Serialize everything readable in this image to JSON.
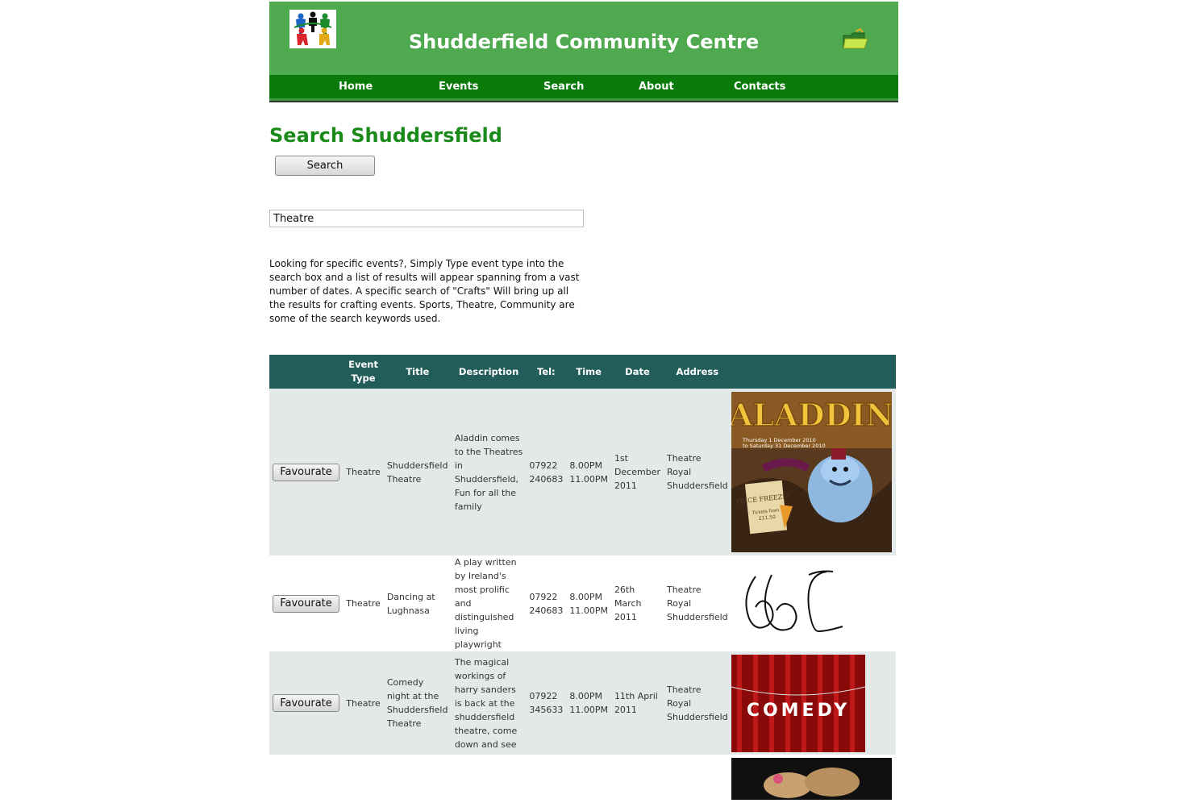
{
  "header": {
    "site_title": "Shudderfield Community Centre",
    "logo_icon": "community-people-logo",
    "folder_icon": "folder-icon"
  },
  "nav": {
    "items": [
      {
        "label": "Home"
      },
      {
        "label": "Events"
      },
      {
        "label": "Search"
      },
      {
        "label": "About"
      },
      {
        "label": "Contacts"
      }
    ]
  },
  "main": {
    "heading": "Search Shuddersfield",
    "search_button": "Search",
    "search_value": "Theatre",
    "help_text": "Looking for specific events?, Simply Type event type into the search box and a list of results will appear spanning from a vast number of dates. A specific search of \"Crafts\" Will bring up all the results for crafting events. Sports, Theatre, Community are some of the search keywords used."
  },
  "table": {
    "headers": {
      "event_type": "Event Type",
      "title": "Title",
      "description": "Description",
      "tel": "Tel:",
      "time": "Time",
      "date": "Date",
      "address": "Address"
    },
    "favourite_label": "Favourate",
    "rows": [
      {
        "event_type": "Theatre",
        "title": "Shuddersfield Theatre",
        "description": "Aladdin comes to the Theatres in Shuddersfield, Fun for all the family",
        "tel": "07922 240683",
        "time": "8.00PM 11.00PM",
        "date": "1st December 2011",
        "address": "Theatre Royal Shuddersfield",
        "poster": {
          "title": "ALADDIN",
          "dates_line1": "Thursday 1 December 2010",
          "dates_line2": "to Saturday 31 December 2010",
          "scroll_text": "PRICE FREEZE!",
          "price_line1": "Tickets from",
          "price_line2": "£11.50"
        }
      },
      {
        "event_type": "Theatre",
        "title": "Dancing at Lughnasa",
        "description": "A play written by Ireland's most prolific and distinguished living playwright",
        "tel": "07922 240683",
        "time": "8.00PM 11.00PM",
        "date": "26th March 2011",
        "address": "Theatre Royal Shuddersfield"
      },
      {
        "event_type": "Theatre",
        "title": "Comedy night at the Shuddersfield Theatre",
        "description": "The magical workings of harry sanders is back at the shuddersfield theatre, come down and see",
        "tel": "07922 345633",
        "time": "8.00PM 11.00PM",
        "date": "11th April 2011",
        "address": "Theatre Royal Shuddersfield",
        "poster": {
          "title": "COMEDY"
        }
      }
    ]
  },
  "colors": {
    "header_green": "#4fa94f",
    "nav_green": "#0a7a0a",
    "heading_green": "#1a8a1a",
    "table_header": "#225d5a",
    "row_shade": "#e3e9e9"
  }
}
